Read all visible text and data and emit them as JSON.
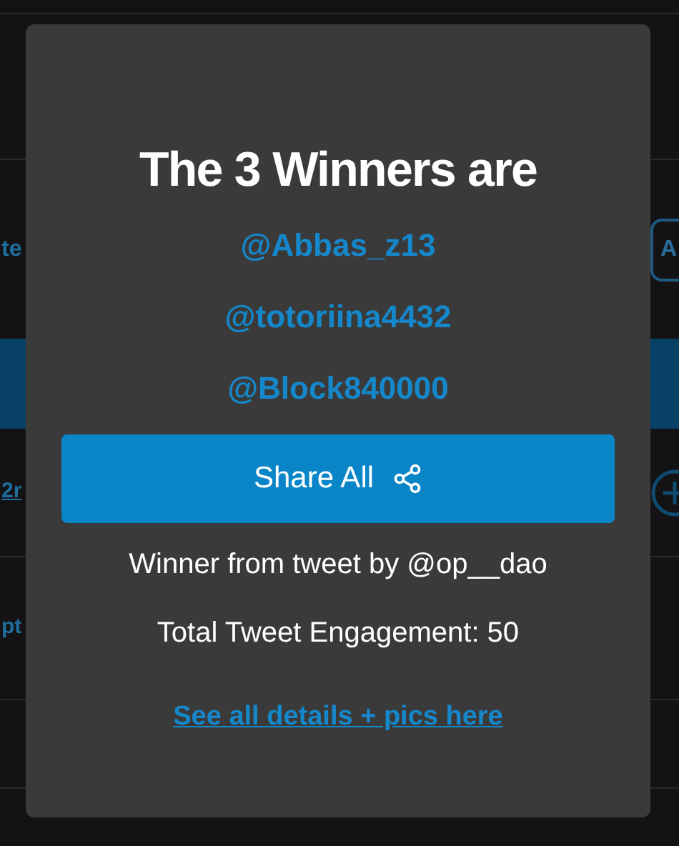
{
  "background": {
    "cell_text": "te",
    "link_text": "2r",
    "option_text": "pt",
    "button_text": "A"
  },
  "modal": {
    "title": "The 3 Winners are",
    "winners": [
      "@Abbas_z13",
      "@totoriina4432",
      "@Block840000"
    ],
    "share_button": "Share All",
    "source": "Winner from tweet by @op__dao",
    "engagement": "Total Tweet Engagement: 50",
    "details_link": "See all details + pics here"
  }
}
